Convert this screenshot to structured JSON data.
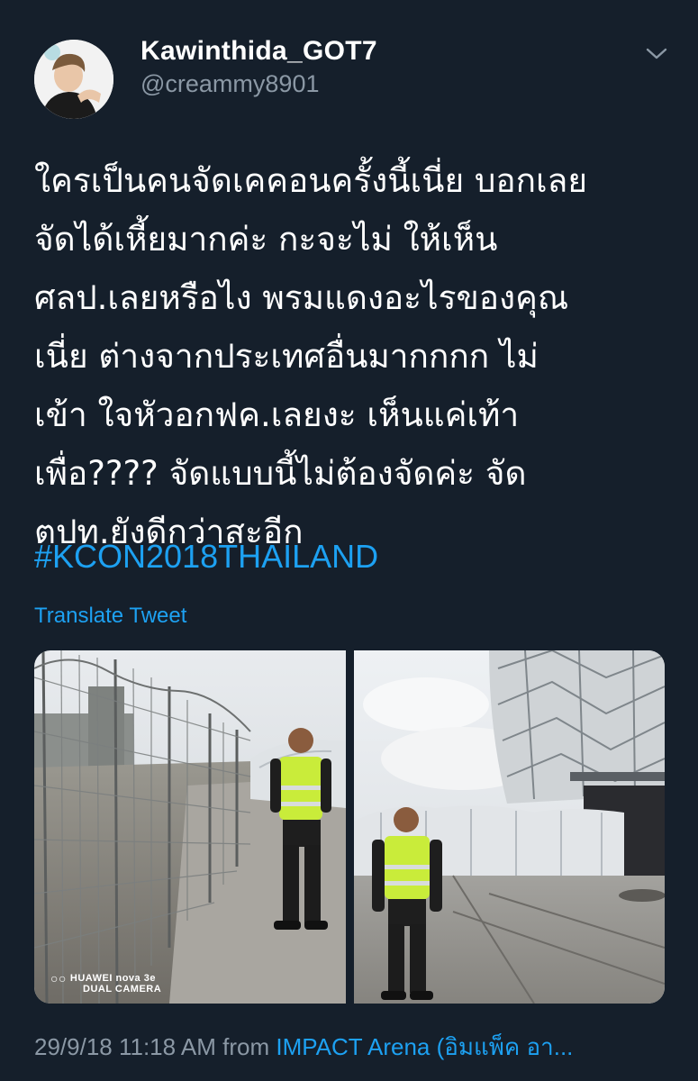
{
  "user": {
    "display_name": "Kawinthida_GOT7",
    "handle": "@creammy8901"
  },
  "tweet": {
    "lines": [
      " ใครเป็นคนจัดเคคอนครั้งนี้เนี่ย บอกเลย",
      "จัดได้เหี้ยมากค่ะ กะจะไม่ ให้เห็น",
      "ศลป.เลยหรือไง พรมแดงอะไรของคุณ",
      "เนี่ย ต่างจากประเทศอื่นมากกกก ไม่",
      "เข้า ใจหัวอกฟค.เลยงะ เห็นแค่เท้า",
      "เพื่อ???? จัดแบบนี้ไม่ต้องจัดค่ะ จัด",
      "ตปท.ยังดีกว่าสะอีก"
    ],
    "hashtag": "#KCON2018THAILAND",
    "translate_label": "Translate Tweet"
  },
  "media": {
    "watermark_brand": "HUAWEI nova 3e",
    "watermark_camera": "DUAL CAMERA"
  },
  "meta": {
    "timestamp": "29/9/18 11:18 AM",
    "from_label": "from",
    "location": "IMPACT Arena (อิมแพ็ค อา..."
  },
  "colors": {
    "background": "#151f2b",
    "text": "#ffffff",
    "secondary": "#8b98a5",
    "accent": "#1da1f2"
  },
  "icons": {
    "menu": "chevron-down-icon"
  }
}
